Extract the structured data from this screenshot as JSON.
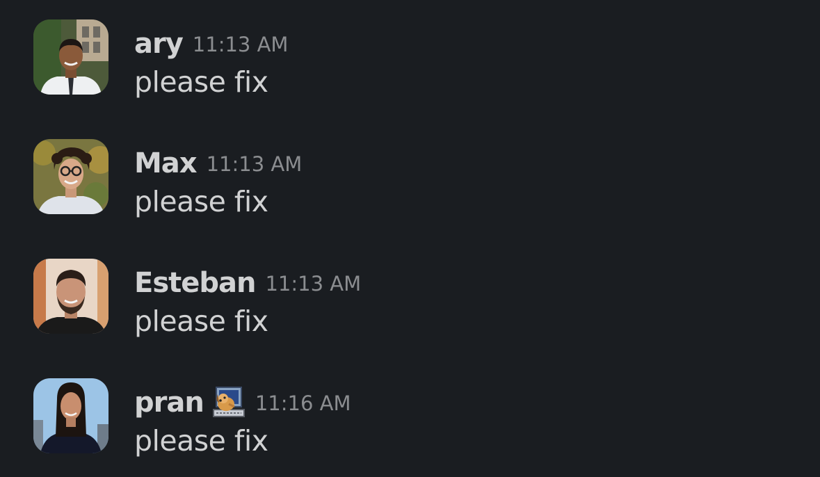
{
  "messages": [
    {
      "author": "ary",
      "time": "11:13 AM",
      "text": "please fix",
      "avatar": "avatar-ary"
    },
    {
      "author": "Max",
      "time": "11:13 AM",
      "text": "please fix",
      "avatar": "avatar-max"
    },
    {
      "author": "Esteban",
      "time": "11:13 AM",
      "text": "please fix",
      "avatar": "avatar-esteban"
    },
    {
      "author": "pran",
      "time": "11:16 AM",
      "text": "please fix",
      "avatar": "avatar-pran",
      "status_icon": "dog-computer-emoji-icon"
    }
  ],
  "colors": {
    "background": "#1a1d21",
    "author_name": "#d1d2d3",
    "timestamp": "#8b8d90",
    "message_text": "#d1d2d3"
  }
}
